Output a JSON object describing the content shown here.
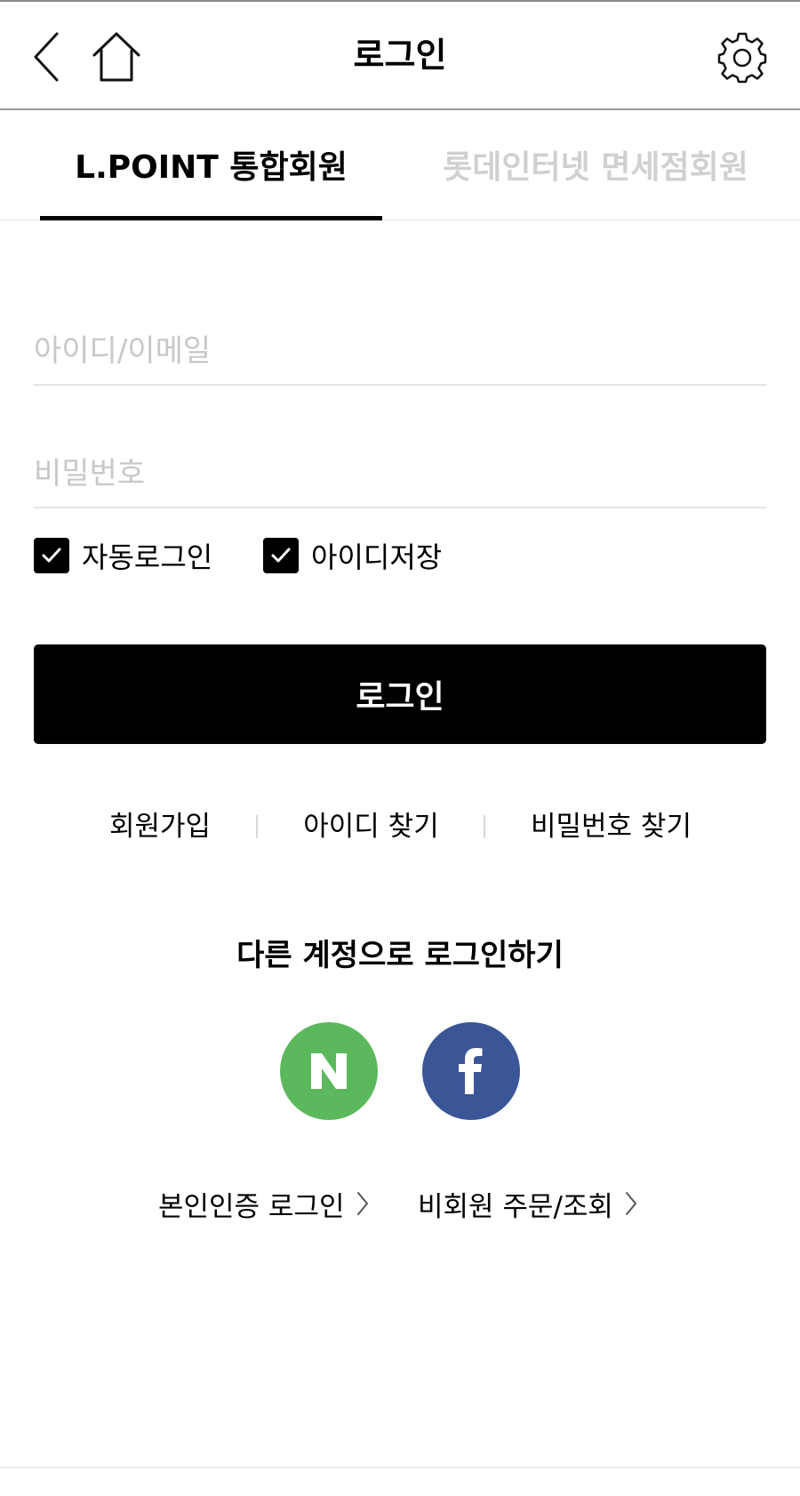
{
  "header": {
    "title": "로그인",
    "icons": {
      "back": "chevron-left-icon",
      "home": "home-icon",
      "settings": "gear-icon"
    }
  },
  "tabs": [
    {
      "label": "L.POINT 통합회원",
      "active": true
    },
    {
      "label": "롯데인터넷 면세점회원",
      "active": false
    }
  ],
  "form": {
    "id_placeholder": "아이디/이메일",
    "id_value": "",
    "password_placeholder": "비밀번호",
    "password_value": "",
    "auto_login": {
      "label": "자동로그인",
      "checked": true
    },
    "save_id": {
      "label": "아이디저장",
      "checked": true
    },
    "login_button": "로그인"
  },
  "links": {
    "join": "회원가입",
    "find_id": "아이디 찾기",
    "find_password": "비밀번호 찾기"
  },
  "other_login": {
    "title": "다른 계정으로 로그인하기",
    "providers": [
      {
        "name": "N",
        "icon": "naver-icon",
        "color": "#5cb85c"
      },
      {
        "name": "f",
        "icon": "facebook-icon",
        "color": "#3b5697"
      }
    ]
  },
  "bottom_links": {
    "identity_login": "본인인증 로그인",
    "guest_order": "비회원 주문/조회"
  },
  "colors": {
    "primary": "#000000",
    "inactive_tab": "#d0d0d0",
    "placeholder": "#c8c8c8"
  }
}
